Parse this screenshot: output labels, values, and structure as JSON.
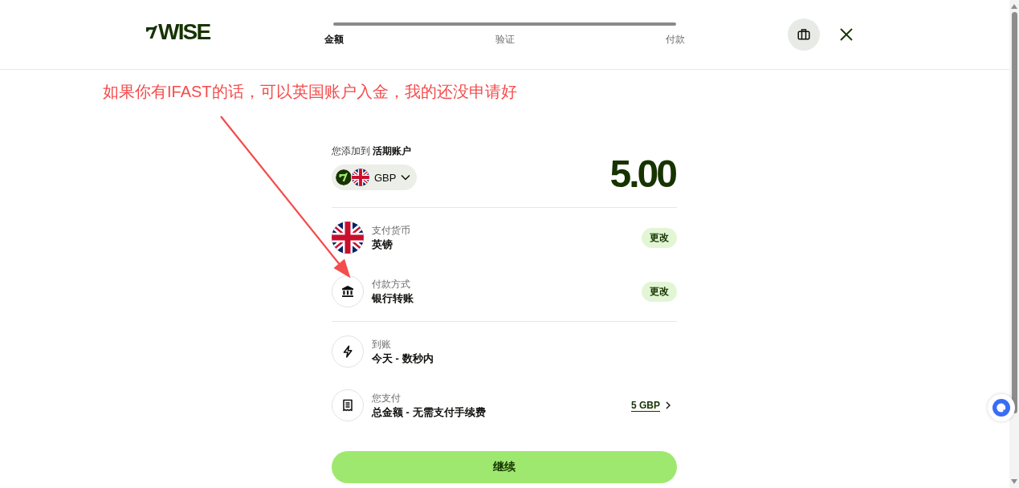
{
  "header": {
    "brand": "WISE",
    "steps": [
      {
        "label": "金额",
        "selected": true
      },
      {
        "label": "验证",
        "selected": false
      },
      {
        "label": "付款",
        "selected": false
      }
    ]
  },
  "annotation": {
    "text": "如果你有IFAST的话，可以英国账户入金，我的还没申请好"
  },
  "summary": "您添加到 **活期账户**",
  "currency_select": {
    "code": "GBP"
  },
  "amount": "5.00",
  "sections": [
    {
      "rows": [
        {
          "kind": "flag",
          "label": "支付货币",
          "value": "英镑",
          "action": "更改"
        },
        {
          "kind": "bank",
          "label": "付款方式",
          "value": "银行转账",
          "action": "更改"
        }
      ]
    },
    {
      "rows": [
        {
          "kind": "lightning",
          "label": "到账",
          "value": "今天 - 数秒内"
        },
        {
          "kind": "receipt",
          "label": "您支付",
          "value": "总金额 - 无需支付手续费",
          "link": "5 GBP"
        }
      ]
    }
  ],
  "continue_button": "继续"
}
